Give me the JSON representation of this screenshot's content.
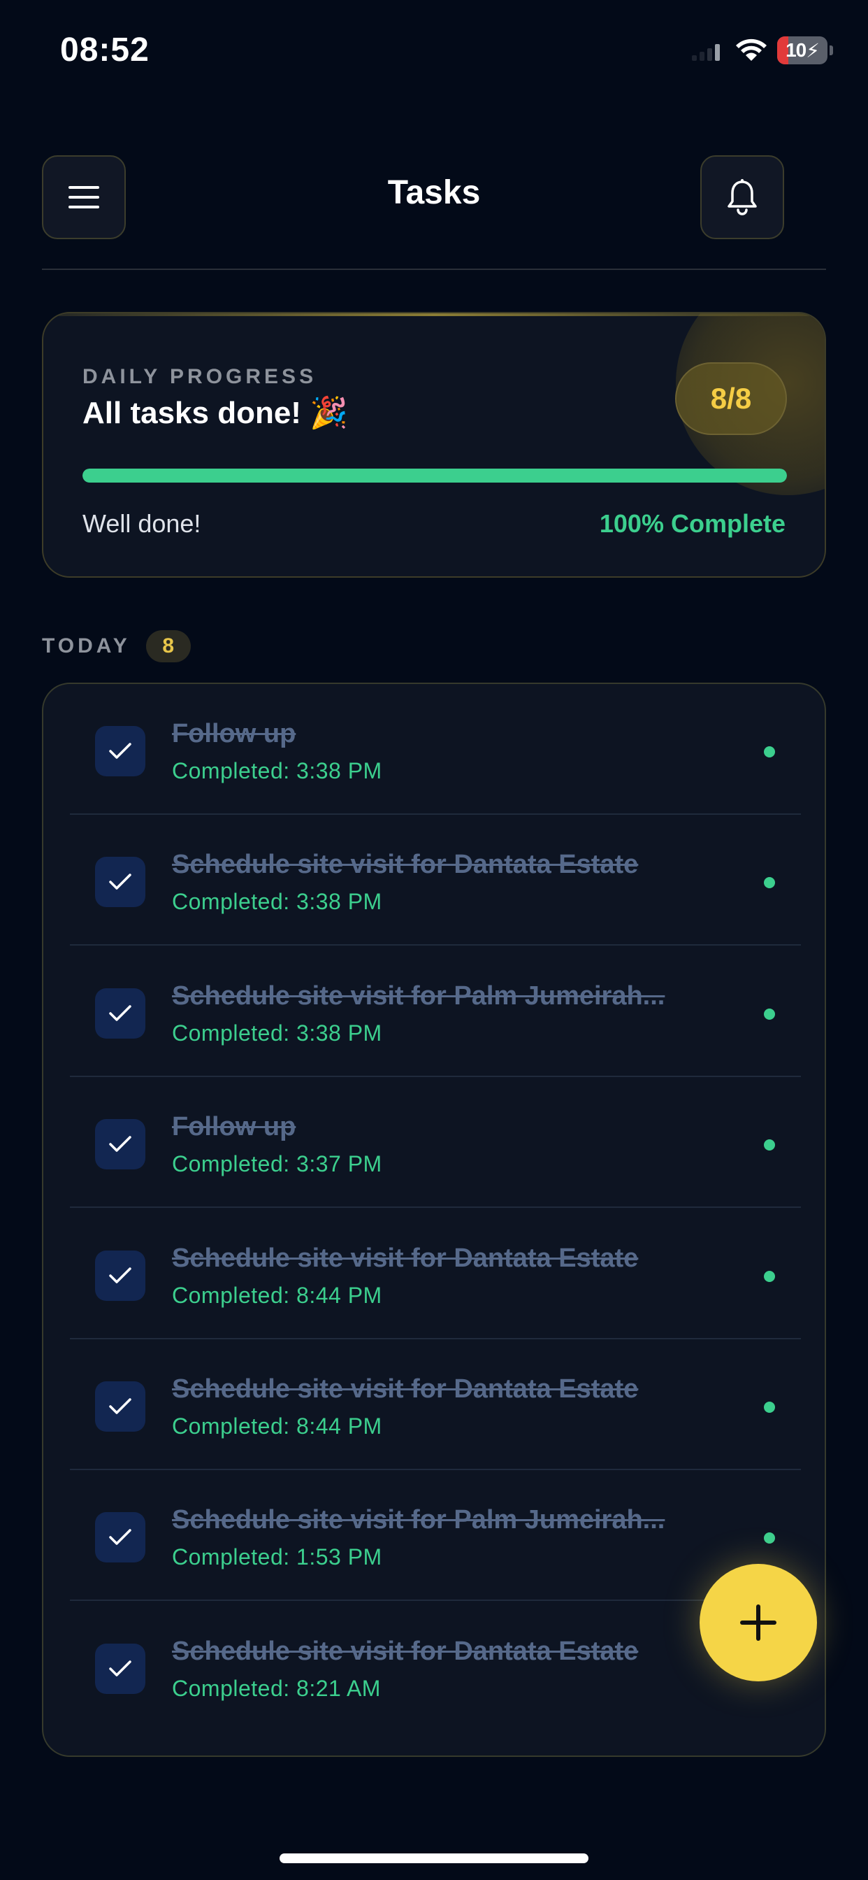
{
  "status_bar": {
    "time": "08:52",
    "battery_level": "10",
    "battery_color": "#e23a3a",
    "icons": [
      "signal-icon",
      "wifi-icon",
      "battery-charging-icon"
    ]
  },
  "header": {
    "title": "Tasks",
    "left_icon": "menu-icon",
    "right_icon": "bell-icon"
  },
  "progress": {
    "label": "DAILY PROGRESS",
    "title": "All tasks done! 🎉",
    "count": "8/8",
    "fraction": 1.0,
    "message": "Well done!",
    "percent_text": "100% Complete"
  },
  "section": {
    "title": "TODAY",
    "count": "8"
  },
  "tasks": [
    {
      "title": "Follow up",
      "time": "Completed: 3:38 PM"
    },
    {
      "title": "Schedule site visit for Dantata Estate",
      "time": "Completed: 3:38 PM"
    },
    {
      "title": "Schedule site visit for Palm Jumeirah...",
      "time": "Completed: 3:38 PM"
    },
    {
      "title": "Follow up",
      "time": "Completed: 3:37 PM"
    },
    {
      "title": "Schedule site visit for Dantata Estate",
      "time": "Completed: 8:44 PM"
    },
    {
      "title": "Schedule site visit for Dantata Estate",
      "time": "Completed: 8:44 PM"
    },
    {
      "title": "Schedule site visit for Palm Jumeirah...",
      "time": "Completed: 1:53 PM"
    },
    {
      "title": "Schedule site visit for Dantata Estate",
      "time": "Completed: 8:21 AM"
    }
  ],
  "fab": {
    "icon": "plus-icon"
  },
  "colors": {
    "background": "#030a18",
    "accent_yellow": "#f5d547",
    "success_green": "#3ccf8e",
    "card_background": "#0d1422"
  }
}
